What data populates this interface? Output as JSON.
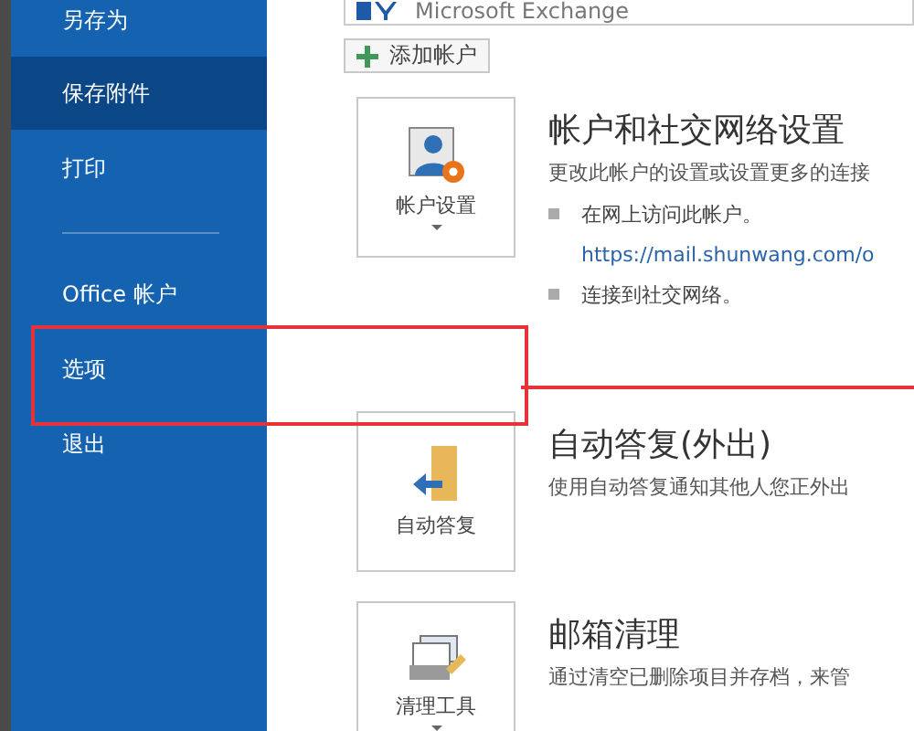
{
  "sidebar": {
    "items": [
      {
        "label": "另存为",
        "selected": false
      },
      {
        "label": "保存附件",
        "selected": true
      },
      {
        "label": "打印",
        "selected": false
      },
      {
        "kind": "divider"
      },
      {
        "label": "Office 帐户",
        "selected": false
      },
      {
        "label": "选项",
        "selected": false
      },
      {
        "label": "退出",
        "selected": false
      }
    ]
  },
  "account_selector": {
    "value": "Microsoft Exchange"
  },
  "add_account_button": {
    "label": "添加帐户"
  },
  "sections": [
    {
      "kind": "account",
      "tile_label": "帐户设置",
      "tile_caret": true,
      "title": "帐户和社交网络设置",
      "description": "更改此帐户的设置或设置更多的连接",
      "bullets": [
        {
          "text": "在网上访问此帐户。",
          "link": "https://mail.shunwang.com/o"
        },
        {
          "text": "连接到社交网络。"
        }
      ]
    },
    {
      "kind": "door",
      "tile_label": "自动答复",
      "tile_caret": false,
      "title": "自动答复(外出)",
      "description": "使用自动答复通知其他人您正外出"
    },
    {
      "kind": "cleanup",
      "tile_label": "清理工具",
      "tile_caret": true,
      "title": "邮箱清理",
      "description": "通过清空已删除项目并存档，来管"
    }
  ]
}
